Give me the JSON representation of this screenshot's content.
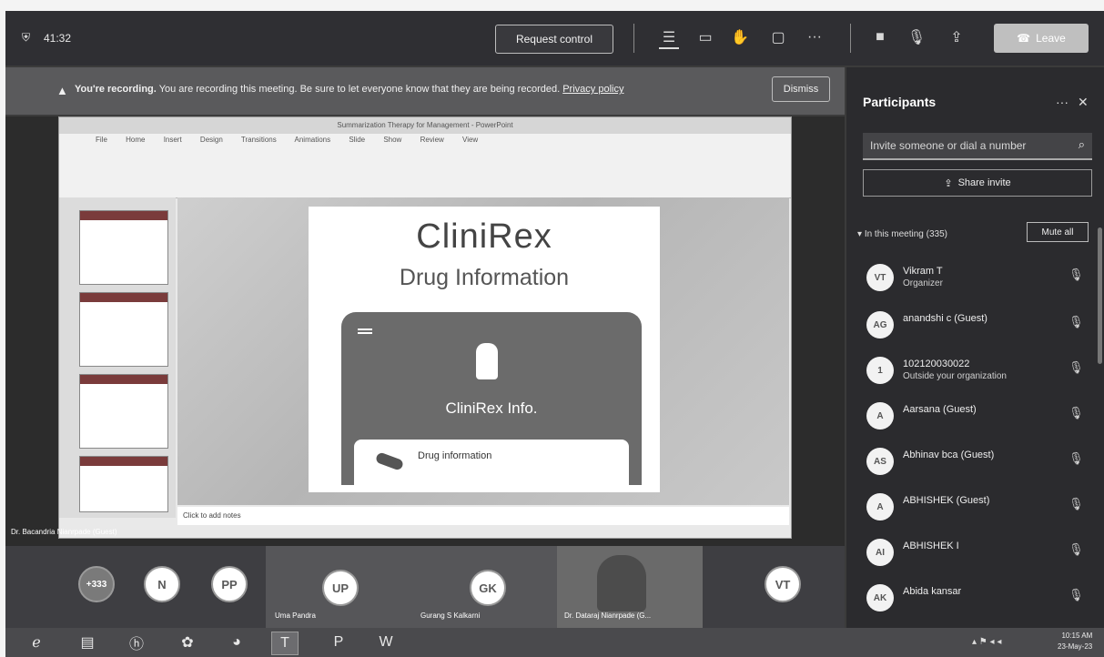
{
  "topbar": {
    "timer": "41:32",
    "request_control": "Request control",
    "leave": "Leave",
    "icons": [
      "shield-icon",
      "participants-icon",
      "chat-icon",
      "raise-hand-icon",
      "rooms-icon",
      "more-icon",
      "camera-icon",
      "mic-icon",
      "share-icon",
      "phone-icon"
    ]
  },
  "banner": {
    "bold": "You're recording.",
    "text": "You are recording this meeting. Be sure to let everyone know that they are being recorded.",
    "link": "Privacy policy",
    "dismiss": "Dismiss"
  },
  "presentation": {
    "window_title": "Summarization Therapy for Management - PowerPoint",
    "ribbon_tabs": [
      "File",
      "Home",
      "Insert",
      "Design",
      "Transitions",
      "Animations",
      "Slide Show",
      "Review",
      "View"
    ],
    "slide_brand": "CliniRex",
    "slide_subtitle": "Drug Information",
    "card_name": "CliniRex Info.",
    "card_inner": "Drug information",
    "notes": "Click to add notes",
    "presenter_label": "Dr. Bacandria Nianrpade (Guest)"
  },
  "strip": {
    "avatars": [
      {
        "initials": "+333"
      },
      {
        "initials": "N"
      },
      {
        "initials": "PP"
      },
      {
        "initials": "UP",
        "name": "Uma Pandra"
      },
      {
        "initials": "GK",
        "name": "Gurang S Kalkarni"
      },
      {
        "initials": "",
        "name": "Dr. Dataraj Nianrpade (G..."
      },
      {
        "initials": "VT"
      }
    ]
  },
  "panel": {
    "title": "Participants",
    "invite_placeholder": "Invite someone or dial a number",
    "share_invite": "Share invite",
    "section": "In this meeting (335)",
    "mute_all": "Mute all",
    "participants": [
      {
        "initials": "VT",
        "name": "Vikram T",
        "role": "Organizer"
      },
      {
        "initials": "AG",
        "name": "anandshi c (Guest)",
        "role": ""
      },
      {
        "initials": "1",
        "name": "102120030022",
        "role": "Outside your organization"
      },
      {
        "initials": "A",
        "name": "Aarsana (Guest)",
        "role": ""
      },
      {
        "initials": "AS",
        "name": "Abhinav bca (Guest)",
        "role": ""
      },
      {
        "initials": "A",
        "name": "ABHISHEK (Guest)",
        "role": ""
      },
      {
        "initials": "AI",
        "name": "ABHISHEK I",
        "role": ""
      },
      {
        "initials": "AK",
        "name": "Abida kansar",
        "role": ""
      }
    ]
  },
  "taskbar": {
    "time": "10:15 AM",
    "date": "23-May-23",
    "apps": [
      "ie-icon",
      "folder-icon",
      "hp-icon",
      "paint-icon",
      "gimp-icon",
      "teams-icon",
      "powerpoint-icon",
      "word-icon"
    ]
  }
}
